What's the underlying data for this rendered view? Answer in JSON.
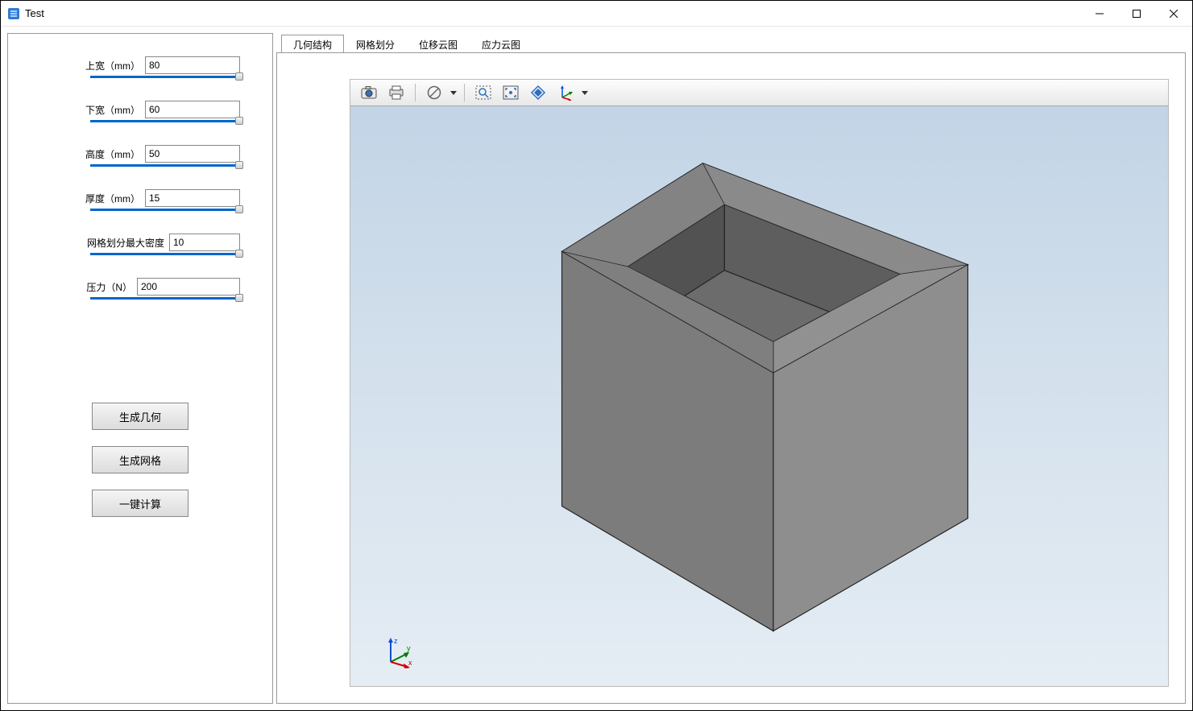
{
  "window": {
    "title": "Test"
  },
  "sidebar": {
    "params": [
      {
        "label": "上宽（mm）",
        "value": "80"
      },
      {
        "label": "下宽（mm）",
        "value": "60"
      },
      {
        "label": "高度（mm）",
        "value": "50"
      },
      {
        "label": "厚度（mm）",
        "value": "15"
      },
      {
        "label": "网格划分最大密度",
        "value": "10"
      },
      {
        "label": "压力（N）",
        "value": "200"
      }
    ],
    "buttons": {
      "gen_geometry": "生成几何",
      "gen_mesh": "生成网格",
      "compute": "一键计算"
    }
  },
  "tabs": {
    "items": [
      {
        "label": "几何结构"
      },
      {
        "label": "网格划分"
      },
      {
        "label": "位移云图"
      },
      {
        "label": "应力云图"
      }
    ],
    "active_index": 0
  },
  "viewer_toolbar": {
    "icons": [
      "camera-icon",
      "print-icon",
      "sep",
      "no-entry-icon",
      "dropdown",
      "sep",
      "zoom-box-icon",
      "fit-icon",
      "rotate-icon",
      "axis-icon",
      "dropdown"
    ]
  },
  "axis": {
    "x": "x",
    "y": "y",
    "z": "z"
  }
}
